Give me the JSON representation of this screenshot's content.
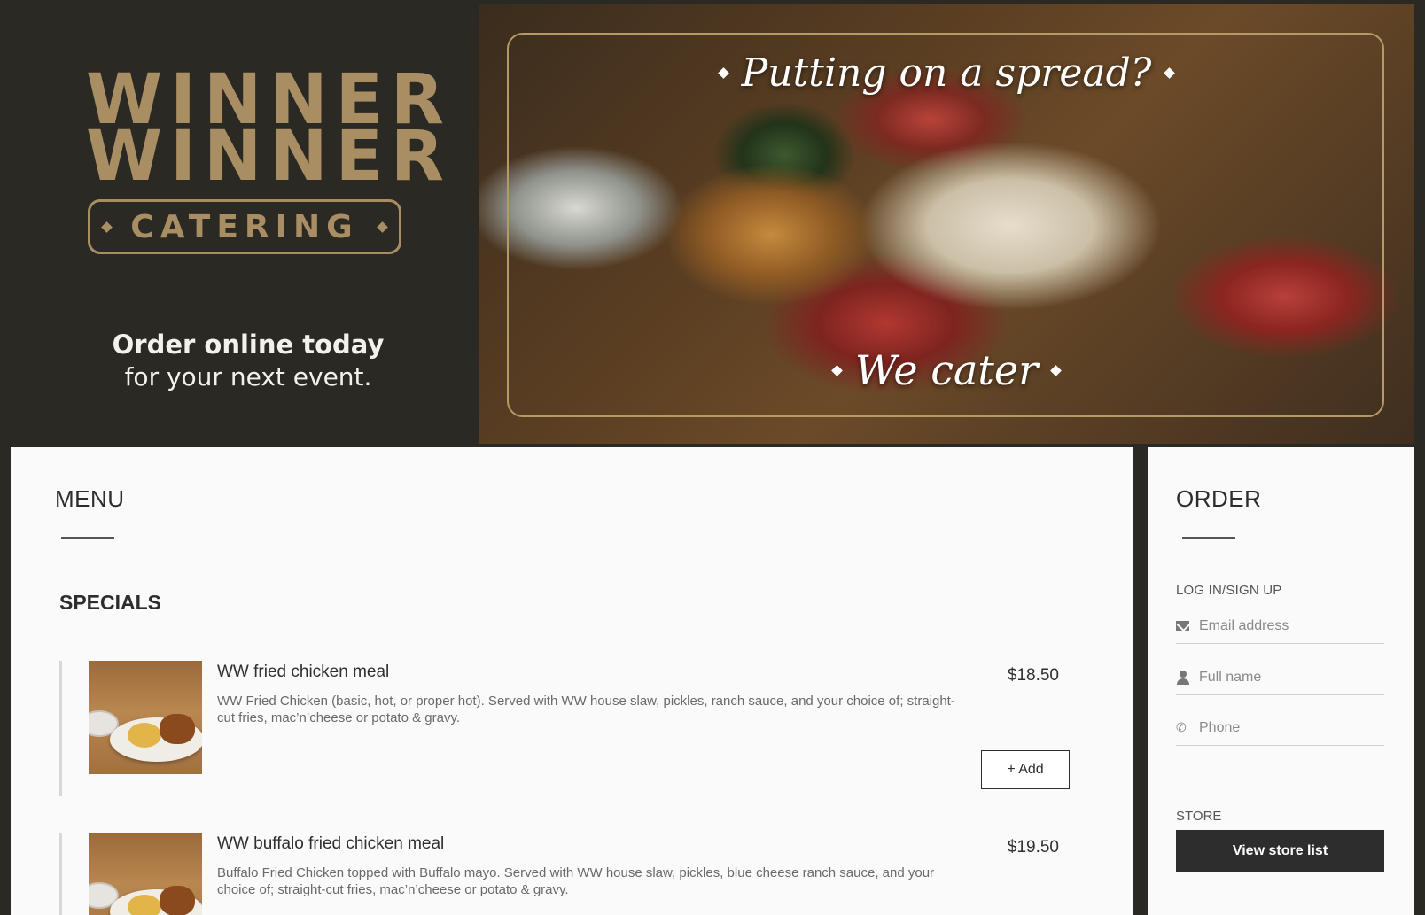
{
  "hero": {
    "logo_line1": "WINNER",
    "logo_line2": "WINNER",
    "logo_sub": "CATERING",
    "tagline_line1": "Order online today",
    "tagline_line2": "for your next event.",
    "headline_top": "Putting on a spread?",
    "headline_bottom": "We cater"
  },
  "menu": {
    "title": "MENU",
    "section_title": "SPECIALS",
    "items": [
      {
        "name": "WW fried chicken meal",
        "description": "WW Fried Chicken (basic, hot, or proper hot). Served with WW house slaw, pickles, ranch sauce, and your choice of; straight-cut fries, mac’n’cheese or potato & gravy.",
        "price": "$18.50",
        "add_label": "+ Add"
      },
      {
        "name": "WW buffalo fried chicken meal",
        "description": "Buffalo Fried Chicken topped with Buffalo mayo. Served with WW house slaw, pickles, blue cheese ranch sauce, and your choice of; straight-cut fries, mac’n’cheese or potato & gravy.",
        "price": "$19.50"
      }
    ]
  },
  "order": {
    "title": "ORDER",
    "login_label": "LOG IN/SIGN UP",
    "email_placeholder": "Email address",
    "name_placeholder": "Full name",
    "phone_placeholder": "Phone",
    "store_label": "STORE",
    "store_button": "View store list"
  },
  "colors": {
    "background": "#2b2924",
    "brand_gold": "#a88e62",
    "panel": "#fafafa",
    "button_dark": "#2d2d2d"
  },
  "icons": [
    "envelope-icon",
    "person-icon",
    "phone-icon"
  ]
}
